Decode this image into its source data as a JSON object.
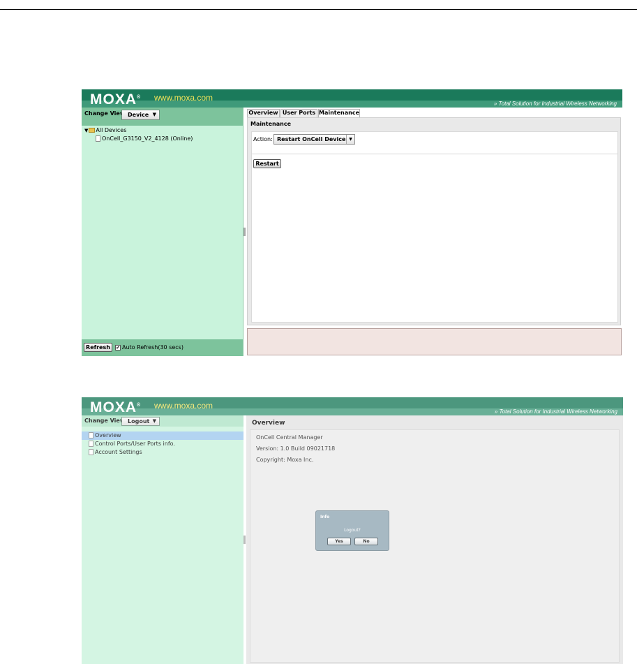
{
  "screen1": {
    "header": {
      "logo": "MOXA",
      "logo_mark": "®",
      "url": "www.moxa.com",
      "tagline": "» Total Solution for Industrial Wireless Networking"
    },
    "sidebar": {
      "change_view_label": "Change View",
      "view_dropdown": {
        "selected": "Device"
      },
      "tree": {
        "root": "All Devices",
        "devices": [
          "OnCell_G3150_V2_4128 (Online)"
        ]
      },
      "footer": {
        "refresh_label": "Refresh",
        "auto_refresh_label": "Auto Refresh(30 secs)",
        "auto_refresh_checked": true
      }
    },
    "tabs": [
      {
        "label": "Overview",
        "active": false
      },
      {
        "label": "User Ports",
        "active": false
      },
      {
        "label": "Maintenance",
        "active": true
      }
    ],
    "maintenance": {
      "title": "Maintenance",
      "action_label": "Action:",
      "action_selected": "Restart OnCell Device",
      "restart_label": "Restart"
    }
  },
  "screen2": {
    "header": {
      "logo": "MOXA",
      "logo_mark": "®",
      "url": "www.moxa.com",
      "tagline": "» Total Solution for Industrial Wireless Networking"
    },
    "sidebar": {
      "change_view_label": "Change View",
      "view_dropdown": {
        "selected": "Logout"
      },
      "items": [
        {
          "label": "Overview",
          "selected": true
        },
        {
          "label": "Control Ports/User Ports info.",
          "selected": false
        },
        {
          "label": "Account Settings",
          "selected": false
        }
      ]
    },
    "overview": {
      "title": "Overview",
      "product": "OnCell Central Manager",
      "version": "Version: 1.0 Build 09021718",
      "copyright": "Copyright: Moxa Inc."
    },
    "dialog": {
      "title": "Info",
      "message": "Logout?",
      "yes_label": "Yes",
      "no_label": "No"
    }
  }
}
